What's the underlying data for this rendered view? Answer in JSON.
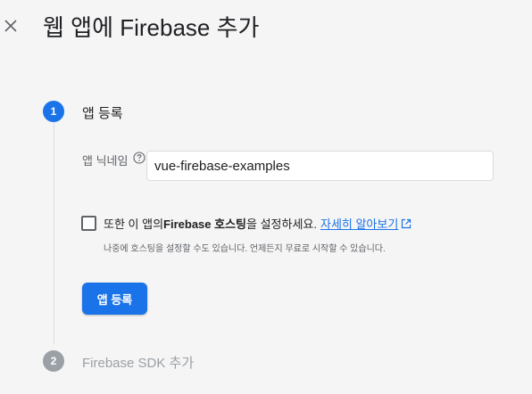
{
  "header": {
    "close_icon": "close-icon",
    "title": "웹 앱에 Firebase 추가"
  },
  "steps": [
    {
      "number": "1",
      "title": "앱 등록",
      "state": "active"
    },
    {
      "number": "2",
      "title": "Firebase SDK 추가",
      "state": "inactive"
    }
  ],
  "register": {
    "nickname_label": "앱 닉네임",
    "help_icon": "help-circle-icon",
    "nickname_value": "vue-firebase-examples",
    "hosting": {
      "checked": false,
      "text_prefix": "또한 이 앱의 ",
      "text_bold": "Firebase 호스팅",
      "text_suffix": "을 설정하세요.",
      "learn_more": "자세히 알아보기",
      "open_icon": "open-in-new-icon"
    },
    "hint": "나중에 호스팅을 설정할 수도 있습니다. 언제든지 무료로 시작할 수 있습니다.",
    "register_button": "앱 등록"
  },
  "colors": {
    "accent": "#1a73e8",
    "inactive": "#9aa0a6",
    "background": "#f5f5f5"
  }
}
